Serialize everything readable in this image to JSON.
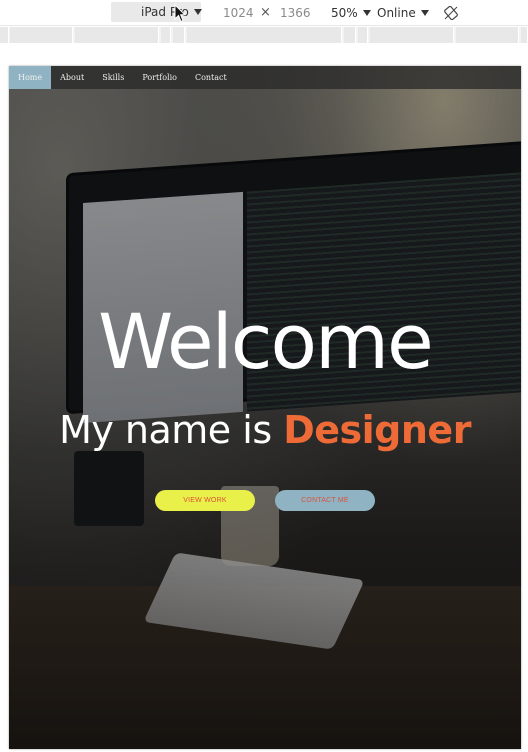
{
  "toolbar": {
    "device": "iPad Pro",
    "width": "1024",
    "times": "×",
    "height": "1366",
    "zoom": "50%",
    "network": "Online"
  },
  "nav": {
    "items": [
      {
        "label": "Home"
      },
      {
        "label": "About"
      },
      {
        "label": "Skills"
      },
      {
        "label": "Portfolio"
      },
      {
        "label": "Contact"
      }
    ],
    "active_index": 0,
    "active_color": "#8fb3c2"
  },
  "hero": {
    "title": "Welcome",
    "subtitle_prefix": "My name is ",
    "subtitle_accent": "Designer",
    "accent_color": "#ee6b38",
    "buttons": {
      "view_work": {
        "label": "VIEW WORK",
        "bg": "#e9f04a",
        "fg": "#d9533a"
      },
      "contact_me": {
        "label": "CONTACT ME",
        "bg": "#8fb3c2",
        "fg": "#d9533a"
      }
    }
  },
  "icons": {
    "caret": "caret-down-icon",
    "rotate": "rotate-icon",
    "cursor": "mouse-cursor-icon"
  }
}
